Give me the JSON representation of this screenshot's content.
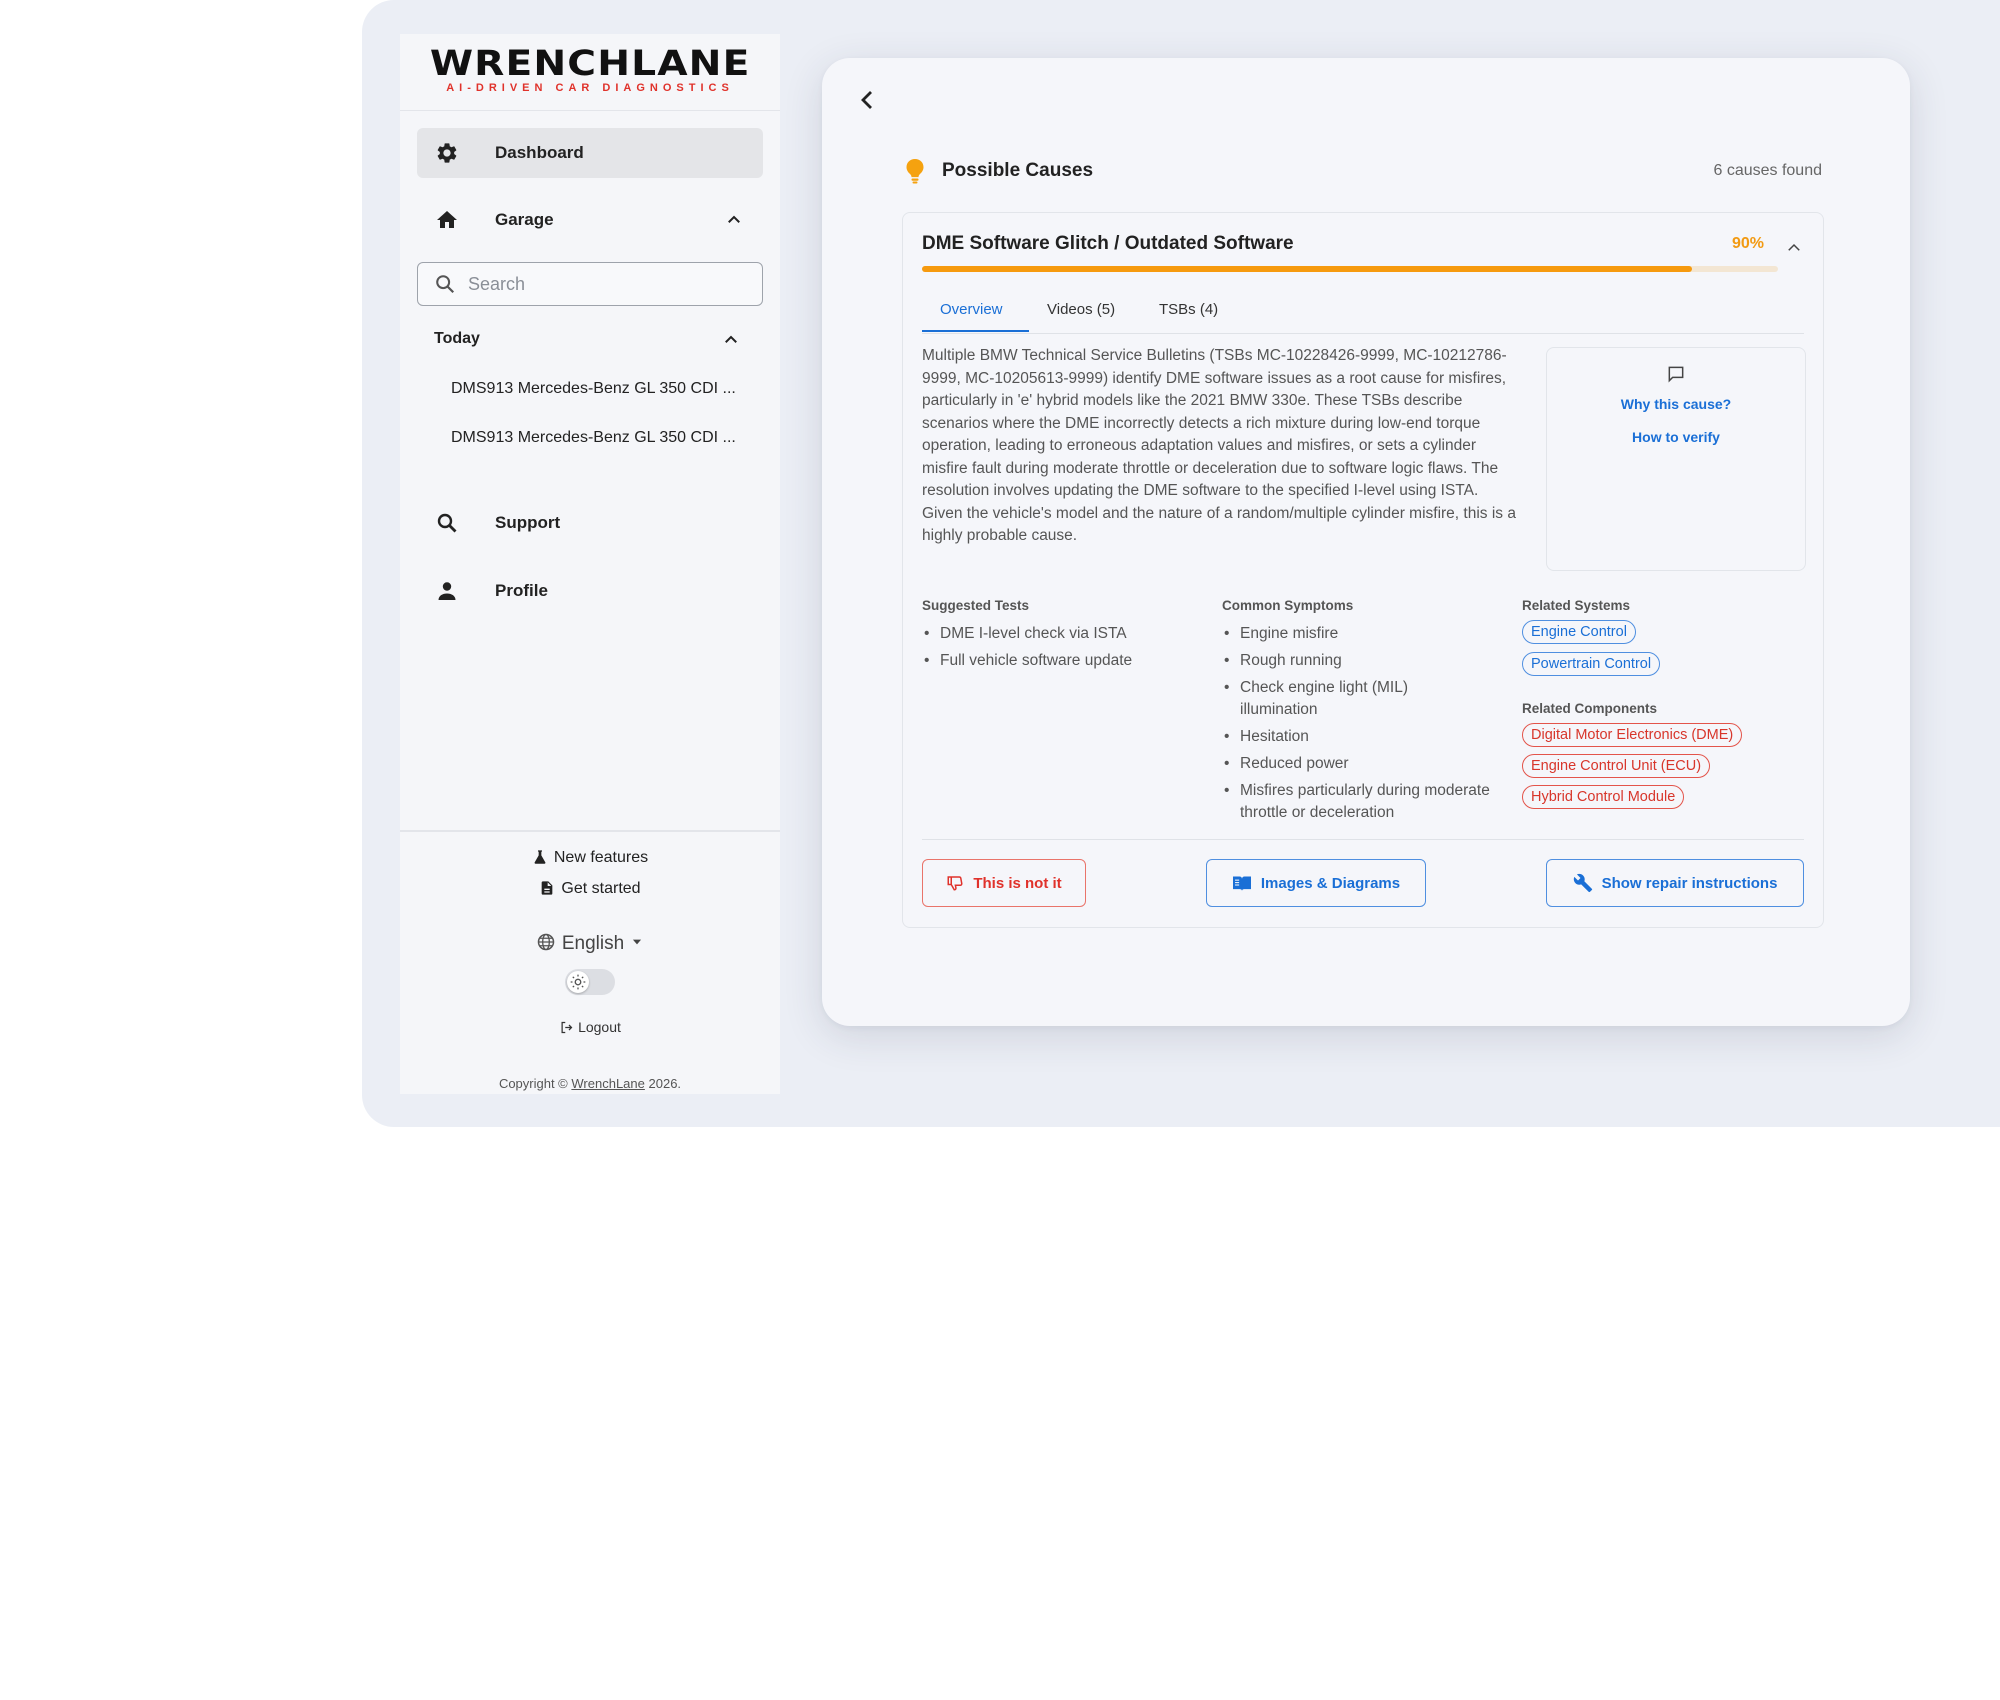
{
  "sidebar": {
    "logo_main": "WRENCHLANE",
    "logo_sub": "AI-DRIVEN CAR DIAGNOSTICS",
    "nav": {
      "dashboard": "Dashboard",
      "garage": "Garage",
      "support": "Support",
      "profile": "Profile"
    },
    "search_placeholder": "Search",
    "today_label": "Today",
    "history": [
      "DMS913 Mercedes-Benz GL 350 CDI ...",
      "DMS913 Mercedes-Benz GL 350 CDI ..."
    ],
    "new_features": "New features",
    "get_started": "Get started",
    "language": "English",
    "logout": "Logout",
    "copyright_prefix": "Copyright ©",
    "copyright_link": "WrenchLane",
    "copyright_year": "2026."
  },
  "panel": {
    "title": "Possible Causes",
    "count": "6 causes found",
    "cause": {
      "title": "DME Software Glitch / Outdated Software",
      "probability_label": "90%",
      "probability": 0.9,
      "tabs": [
        "Overview",
        "Videos (5)",
        "TSBs (4)"
      ],
      "active_tab": "Overview",
      "description": "Multiple BMW Technical Service Bulletins (TSBs MC-10228426-9999, MC-10212786-9999, MC-10205613-9999) identify DME software issues as a root cause for misfires, particularly in 'e' hybrid models like the 2021 BMW 330e. These TSBs describe scenarios where the DME incorrectly detects a rich mixture during low-end torque operation, leading to erroneous adaptation values and misfires, or sets a cylinder misfire fault during moderate throttle or deceleration due to software logic flaws. The resolution involves updating the DME software to the specified I-level using ISTA. Given the vehicle's model and the nature of a random/multiple cylinder misfire, this is a highly probable cause.",
      "why_link": "Why this cause?",
      "verify_link": "How to verify",
      "suggested_tests_label": "Suggested Tests",
      "suggested_tests": [
        "DME I-level check via ISTA",
        "Full vehicle software update"
      ],
      "symptoms_label": "Common Symptoms",
      "symptoms": [
        "Engine misfire",
        "Rough running",
        "Check engine light (MIL) illumination",
        "Hesitation",
        "Reduced power",
        "Misfires particularly during moderate throttle or deceleration"
      ],
      "systems_label": "Related Systems",
      "systems": [
        "Engine Control",
        "Powertrain Control"
      ],
      "components_label": "Related Components",
      "components": [
        "Digital Motor Electronics (DME)",
        "Engine Control Unit (ECU)",
        "Hybrid Control Module"
      ],
      "btn_not_it": "This is not it",
      "btn_images": "Images & Diagrams",
      "btn_repair": "Show repair instructions"
    }
  },
  "colors": {
    "accent_blue": "#1a6fd6",
    "warning_orange": "#f69a0e",
    "danger_red": "#e0322b"
  }
}
